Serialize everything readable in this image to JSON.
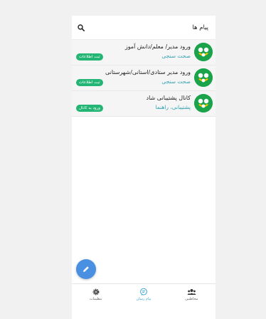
{
  "header": {
    "title": "پیام ها",
    "search_icon": "search-icon"
  },
  "conversations": [
    {
      "name": "ورود مدیر/ معلم/دانش آموز",
      "subtitle": "صحت سنجی",
      "badge": "ثبت اطلاعات",
      "avatar_icon": "app-logo-icon"
    },
    {
      "name": "ورود مدیر ستادی/استانی/شهرستانی",
      "subtitle": "صحت سنجی",
      "badge": "ثبت اطلاعات",
      "avatar_icon": "app-logo-icon"
    },
    {
      "name": "کانال پشتیبانی شاد",
      "subtitle": "پشتیبانی، راهنما",
      "badge": "ورود به کانال",
      "avatar_icon": "app-logo-icon"
    }
  ],
  "fab": {
    "icon": "pencil-icon"
  },
  "bottom_nav": [
    {
      "label": "مخاطبین",
      "icon": "contacts-icon",
      "active": false
    },
    {
      "label": "پیام رسان",
      "icon": "chat-icon",
      "active": true
    },
    {
      "label": "تنظیمات",
      "icon": "gear-icon",
      "active": false
    }
  ],
  "colors": {
    "badge": "#22b573",
    "avatar": "#1aa34a",
    "subtitle": "#2f9fb3",
    "fab": "#4a90e2",
    "active_nav": "#3aa7d8"
  }
}
